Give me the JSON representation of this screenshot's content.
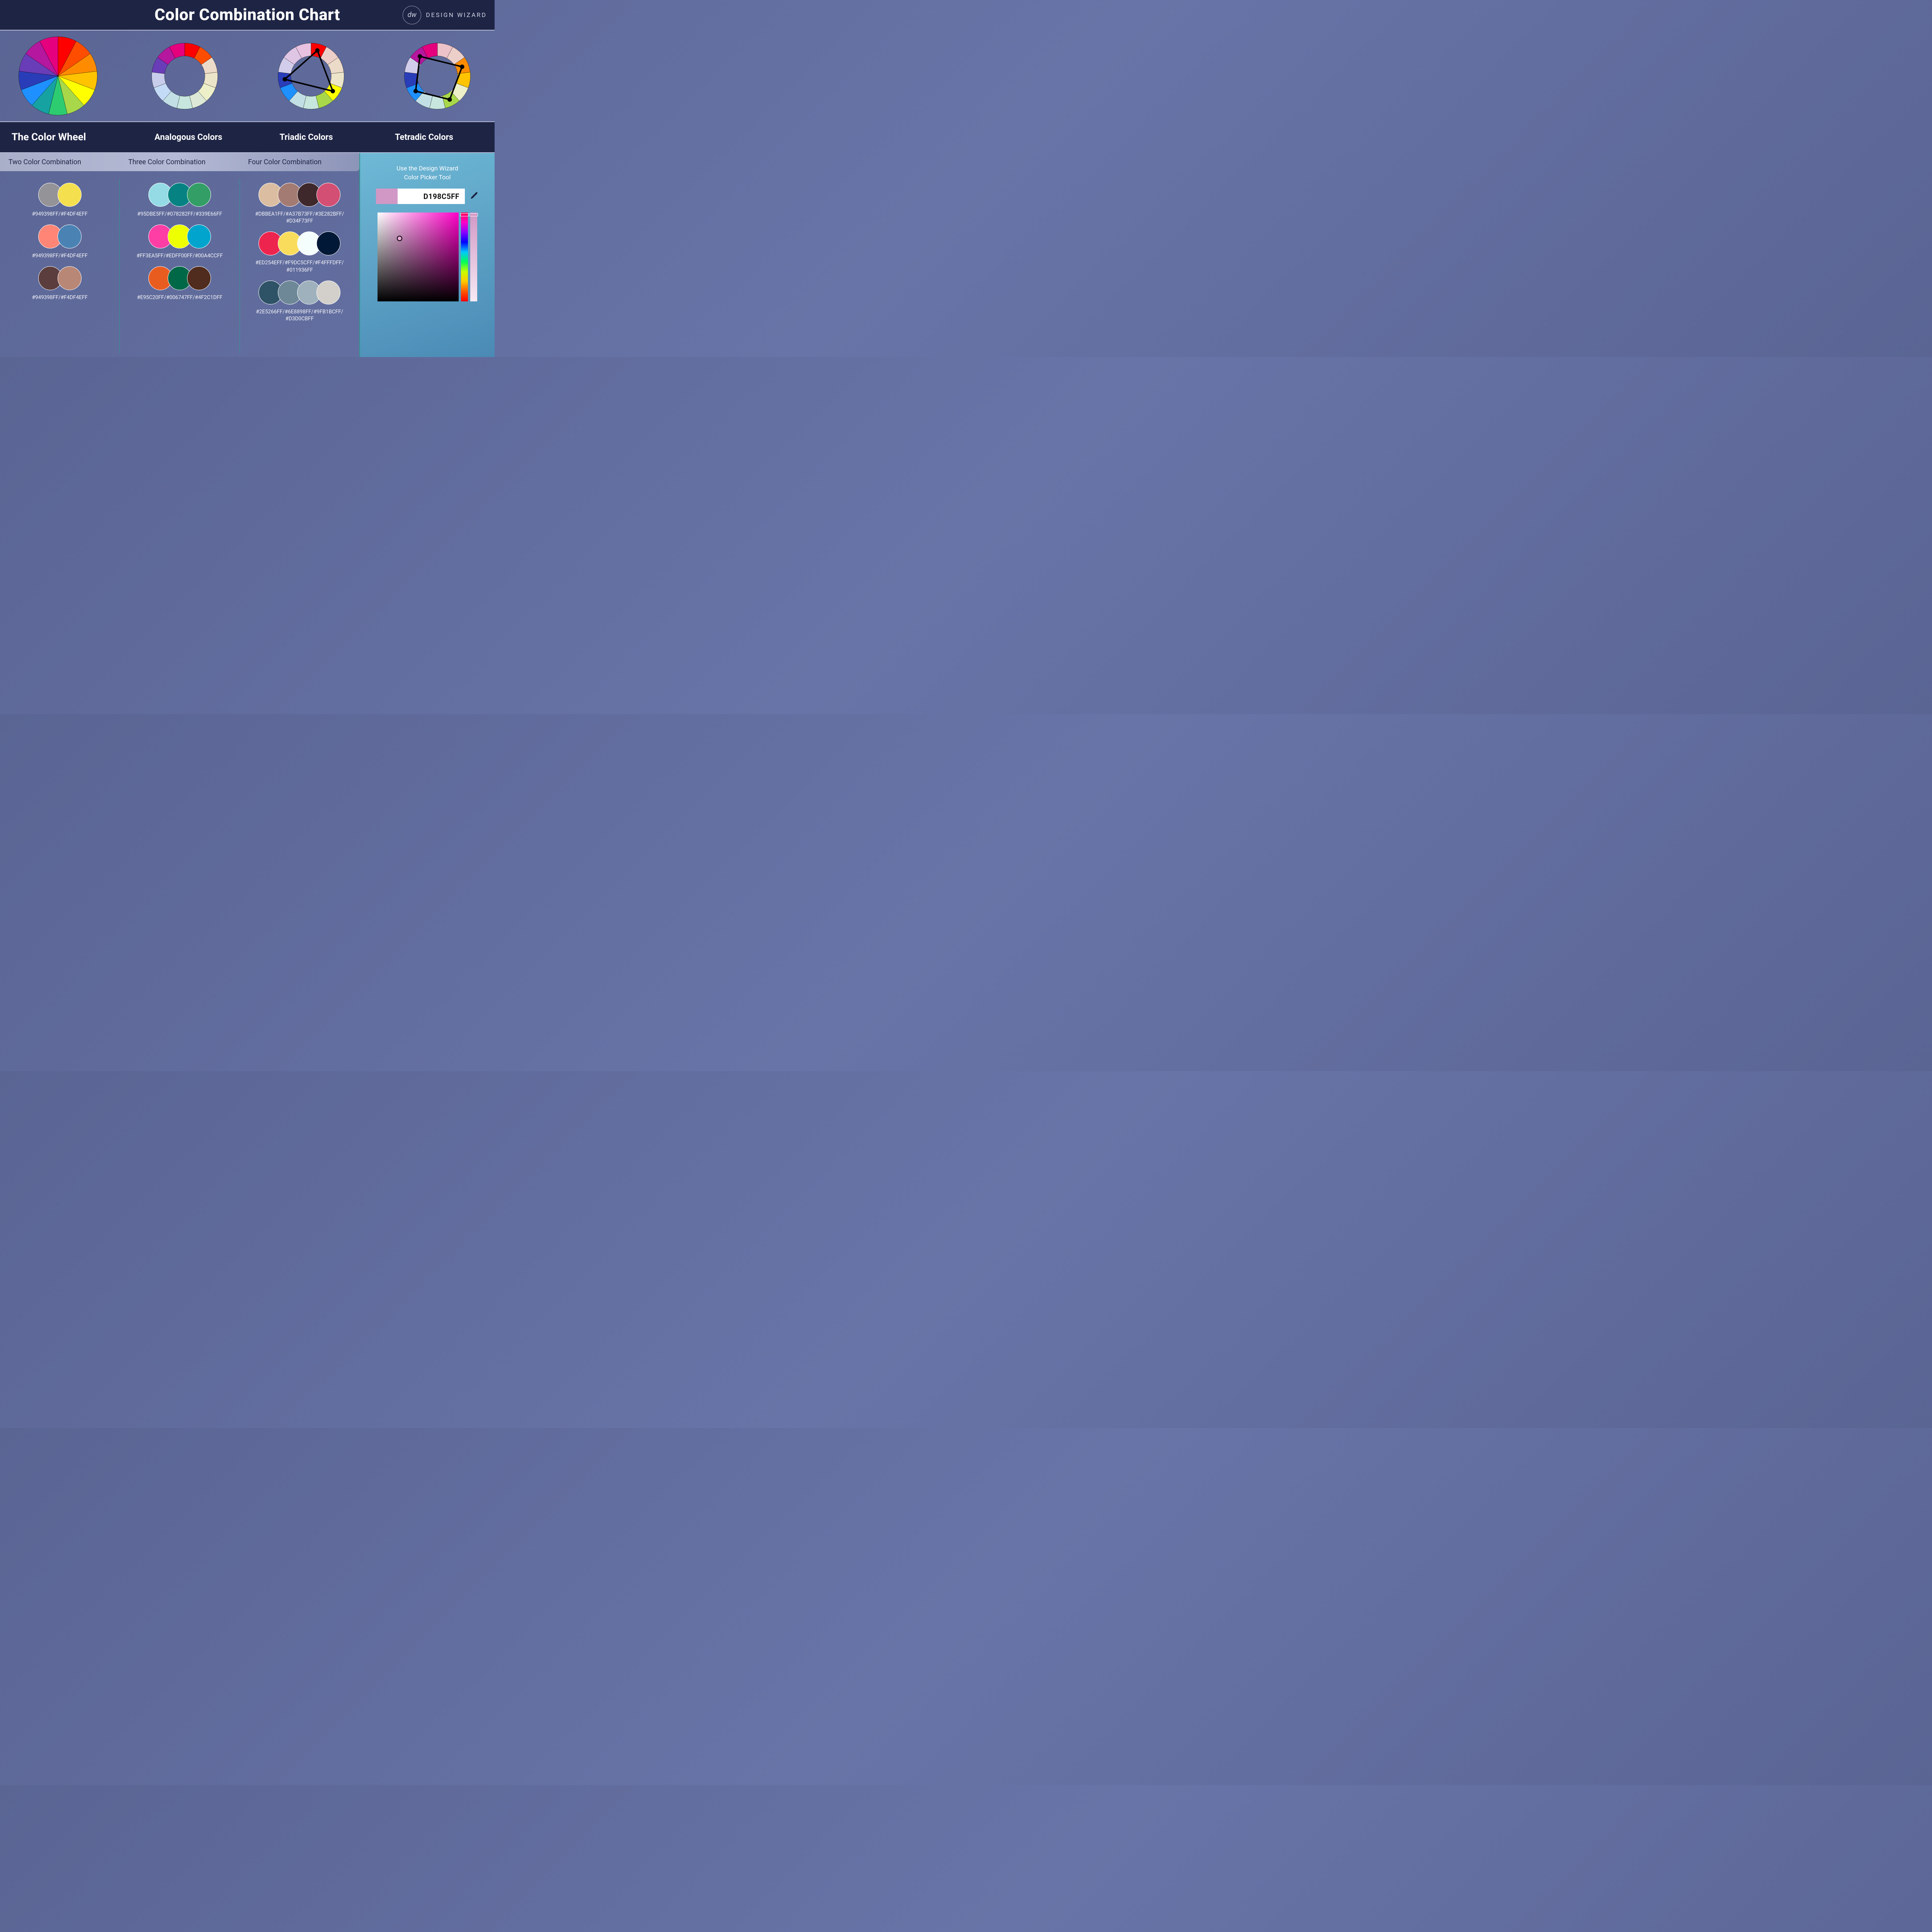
{
  "header": {
    "title": "Color Combination Chart",
    "brand_initials": "dw",
    "brand_name": "DESIGN WIZARD"
  },
  "wheel_colors": [
    "#ff0000",
    "#ff4d00",
    "#ff8c00",
    "#ffc300",
    "#ffff00",
    "#a8d84a",
    "#2ecc71",
    "#17a2a2",
    "#1e90ff",
    "#2a3db8",
    "#6a3db8",
    "#b5179e",
    "#e5007e"
  ],
  "section_labels": {
    "wheel": "The Color Wheel",
    "analogous": "Analogous Colors",
    "triadic": "Triadic Colors",
    "tetradic": "Tetradic Colors"
  },
  "combo_tabs": {
    "two": "Two Color Combination",
    "three": "Three Color Combination",
    "four": "Four Color Combination"
  },
  "combos": {
    "two": [
      {
        "colors": [
          "#949398",
          "#F4DF4E"
        ],
        "label": "#949398FF/#F4DF4EFF"
      },
      {
        "colors": [
          "#ff8576",
          "#4b82b4"
        ],
        "label": "#949398FF/#F4DF4EFF"
      },
      {
        "colors": [
          "#5c3d3d",
          "#b98776"
        ],
        "label": "#949398FF/#F4DF4EFF"
      }
    ],
    "three": [
      {
        "colors": [
          "#95DBE5",
          "#078282",
          "#339E66"
        ],
        "label": "#95DBE5FF/#078282FF/#339E66FF"
      },
      {
        "colors": [
          "#FF3EA5",
          "#EDFF00",
          "#00A4CC"
        ],
        "label": "#FF3EA5FF/#EDFF00FF/#00A4CCFF"
      },
      {
        "colors": [
          "#E95C20",
          "#006747",
          "#4F2C1D"
        ],
        "label": "#E95C20FF/#006747FF/#4F2C1DFF"
      }
    ],
    "four": [
      {
        "colors": [
          "#DBBEA1",
          "#A37B73",
          "#3E282B",
          "#D34F73"
        ],
        "label": "#DBBEA1FF/#A37B73FF/#3E282BFF/\n#D34F73FF"
      },
      {
        "colors": [
          "#ED254E",
          "#F9DC5C",
          "#F4FFFD",
          "#011936"
        ],
        "label": "#ED254EFF/#F9DC5CFF/#F4FFFDFF/\n#011936FF"
      },
      {
        "colors": [
          "#2E5266",
          "#6E8898",
          "#9FB1BC",
          "#D3D0CB"
        ],
        "label": "#2E5266FF/#6E8898FF/#9FB1BCFF/\n#D3D0CBFF"
      }
    ]
  },
  "picker": {
    "prompt_line1": "Use the Design Wizard",
    "prompt_line2": "Color Picker Tool",
    "swatch_color": "#D198C5",
    "value": "D198C5FF"
  }
}
